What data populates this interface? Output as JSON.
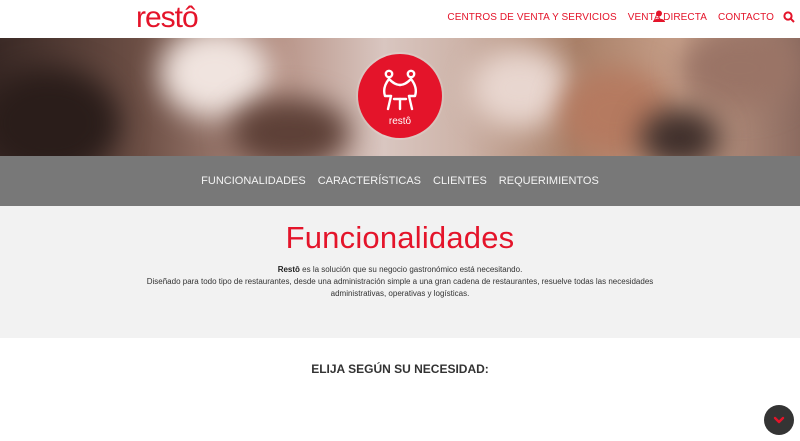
{
  "header": {
    "logo": "restô",
    "nav": [
      "CENTROS DE VENTA Y SERVICIOS",
      "VENTA DIRECTA",
      "CONTACTO"
    ]
  },
  "hero": {
    "badge_text": "restô"
  },
  "subnav": {
    "items": [
      "FUNCIONALIDADES",
      "CARACTERÍSTICAS",
      "CLIENTES",
      "REQUERIMIENTOS"
    ]
  },
  "section": {
    "title": "Funcionalidades",
    "brand": "Restô",
    "line1_rest": " es la solución que su negocio gastronómico está necesitando.",
    "line2": "Diseñado para todo tipo de restaurantes, desde una administración simple a una gran cadena de restaurantes, resuelve todas las necesidades",
    "line3": "administrativas, operativas y logísticas."
  },
  "choose": {
    "heading": "ELIJA SEGÚN SU NECESIDAD:"
  },
  "icons": {
    "user": "user-icon",
    "search": "search-icon",
    "scroll": "chevron-down-icon",
    "badge": "diners-illustration"
  },
  "colors": {
    "brand": "#e4142a",
    "subnav_bg": "#787878",
    "section_bg": "#f2f2f2",
    "scroll_btn": "#343434"
  }
}
